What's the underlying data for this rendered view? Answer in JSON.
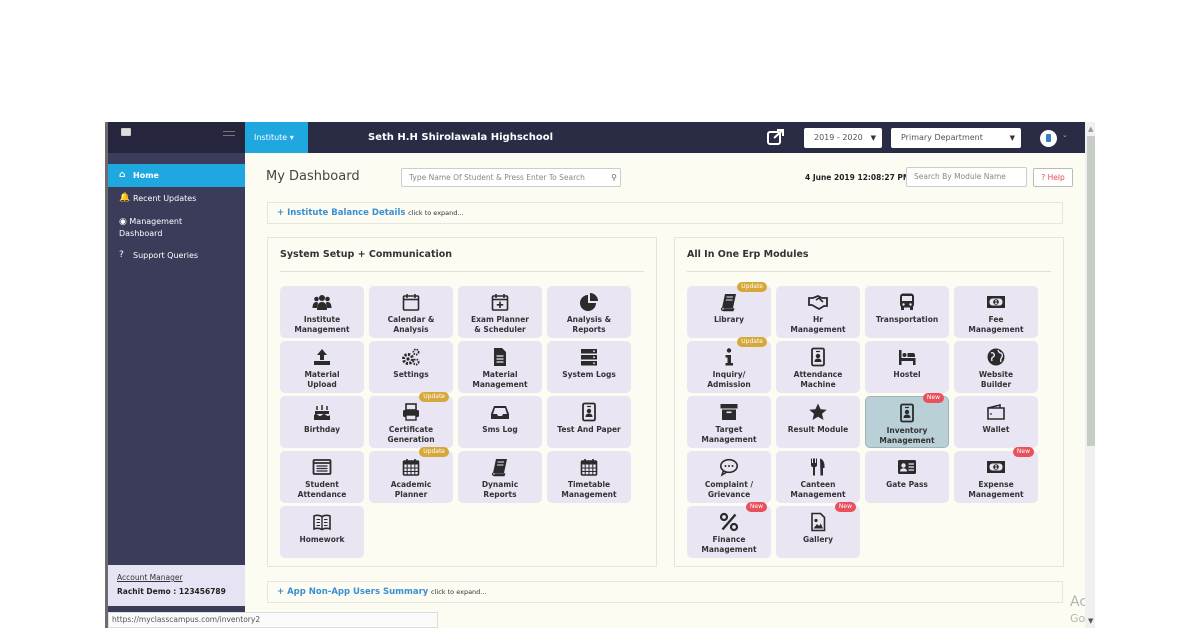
{
  "topbar": {
    "institute_label": "Institute ▾",
    "school_name": "Seth H.H Shirolawala Highschool",
    "year_select": "2019 - 2020",
    "department_select": "Primary Department",
    "dropdown_arrow": "▼",
    "avatar_caret": "⌄"
  },
  "sidebar": {
    "items": [
      {
        "icon": "⌂",
        "label": "Home"
      },
      {
        "icon": "🔔",
        "label": "Recent Updates"
      },
      {
        "icon": "◉",
        "label": "Management",
        "label2": "Dashboard"
      },
      {
        "icon": "?",
        "label": "Support Queries"
      }
    ],
    "account_manager_label": "Account Manager",
    "account_manager_name": "Rachit Demo : 123456789"
  },
  "status_bar": {
    "url": "https://myclasscampus.com/inventory2"
  },
  "main": {
    "title": "My Dashboard",
    "student_search_placeholder": "Type Name Of Student & Press Enter To Search",
    "datetime": "4 June 2019 12:08:27 PM",
    "module_search_placeholder": "Search By Module Name",
    "help_label": "? Help",
    "balance_bar": {
      "title": "+ Institute Balance Details",
      "hint": "click to expand..."
    },
    "users_bar": {
      "title": "+ App Non-App Users Summary",
      "hint": "click to expand..."
    }
  },
  "panels": {
    "left": {
      "title": "System Setup + Communication",
      "tiles": [
        {
          "icon": "users",
          "l1": "Institute",
          "l2": "Management"
        },
        {
          "icon": "calendar",
          "l1": "Calendar &",
          "l2": "Analysis"
        },
        {
          "icon": "calendar-plus",
          "l1": "Exam Planner",
          "l2": "& Scheduler"
        },
        {
          "icon": "pie-chart",
          "l1": "Analysis &",
          "l2": "Reports"
        },
        {
          "icon": "upload",
          "l1": "Material",
          "l2": "Upload"
        },
        {
          "icon": "cogs",
          "l1": "Settings",
          "l2": ""
        },
        {
          "icon": "file",
          "l1": "Material",
          "l2": "Management"
        },
        {
          "icon": "server",
          "l1": "System Logs",
          "l2": ""
        },
        {
          "icon": "birthday",
          "l1": "Birthday",
          "l2": ""
        },
        {
          "icon": "print",
          "l1": "Certificate",
          "l2": "Generation",
          "badge": "Update"
        },
        {
          "icon": "inbox",
          "l1": "Sms Log",
          "l2": ""
        },
        {
          "icon": "id-badge",
          "l1": "Test And Paper",
          "l2": ""
        },
        {
          "icon": "list-alt",
          "l1": "Student",
          "l2": "Attendance"
        },
        {
          "icon": "calendar-grid",
          "l1": "Academic",
          "l2": "Planner",
          "badge": "Update"
        },
        {
          "icon": "book",
          "l1": "Dynamic",
          "l2": "Reports"
        },
        {
          "icon": "calendar-grid",
          "l1": "Timetable",
          "l2": "Management"
        },
        {
          "icon": "open-book",
          "l1": "Homework",
          "l2": ""
        }
      ]
    },
    "right": {
      "title": "All In One Erp Modules",
      "tiles": [
        {
          "icon": "book",
          "l1": "Library",
          "l2": "",
          "badge": "Update"
        },
        {
          "icon": "handshake",
          "l1": "Hr",
          "l2": "Management"
        },
        {
          "icon": "bus",
          "l1": "Transportation",
          "l2": ""
        },
        {
          "icon": "money",
          "l1": "Fee",
          "l2": "Management"
        },
        {
          "icon": "info",
          "l1": "Inquiry/",
          "l2": "Admission",
          "badge": "Update"
        },
        {
          "icon": "id-badge",
          "l1": "Attendance",
          "l2": "Machine"
        },
        {
          "icon": "bed",
          "l1": "Hostel",
          "l2": ""
        },
        {
          "icon": "globe",
          "l1": "Website",
          "l2": "Builder"
        },
        {
          "icon": "archive",
          "l1": "Target",
          "l2": "Management"
        },
        {
          "icon": "star",
          "l1": "Result Module",
          "l2": ""
        },
        {
          "icon": "id-badge",
          "l1": "Inventory",
          "l2": "Management",
          "badge": "New",
          "highlight": true
        },
        {
          "icon": "wallet",
          "l1": "Wallet",
          "l2": ""
        },
        {
          "icon": "comment",
          "l1": "Complaint /",
          "l2": "Grievance"
        },
        {
          "icon": "utensils",
          "l1": "Canteen",
          "l2": "Management"
        },
        {
          "icon": "id-card",
          "l1": "Gate Pass",
          "l2": ""
        },
        {
          "icon": "money",
          "l1": "Expense",
          "l2": "Management",
          "badge": "New"
        },
        {
          "icon": "percent",
          "l1": "Finance",
          "l2": "Management",
          "badge": "New"
        },
        {
          "icon": "image",
          "l1": "Gallery",
          "l2": "",
          "badge": "New"
        }
      ]
    }
  },
  "watermark": {
    "line1": "Activate Windows",
    "line2": "Go to Settings to activate Windows."
  }
}
